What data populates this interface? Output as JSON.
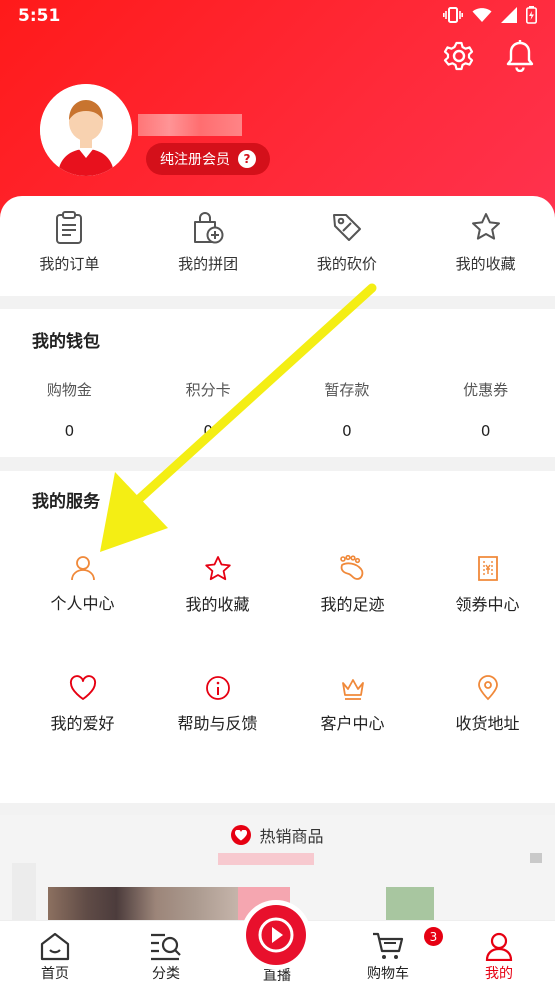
{
  "status_bar": {
    "time": "5:51"
  },
  "profile": {
    "member_label": "纯注册会员",
    "help_glyph": "?"
  },
  "quick_links": [
    {
      "label": "我的订单",
      "icon": "order-clipboard-icon"
    },
    {
      "label": "我的拼团",
      "icon": "group-buy-bag-icon"
    },
    {
      "label": "我的砍价",
      "icon": "bargain-tag-icon"
    },
    {
      "label": "我的收藏",
      "icon": "favorite-star-icon"
    }
  ],
  "wallet": {
    "title": "我的钱包",
    "items": [
      {
        "label": "购物金",
        "value": "0"
      },
      {
        "label": "积分卡",
        "value": "0"
      },
      {
        "label": "暂存款",
        "value": "0"
      },
      {
        "label": "优惠券",
        "value": "0"
      }
    ]
  },
  "services": {
    "title": "我的服务",
    "items": [
      {
        "label": "个人中心",
        "icon": "person-icon"
      },
      {
        "label": "我的收藏",
        "icon": "star-icon"
      },
      {
        "label": "我的足迹",
        "icon": "footprint-icon"
      },
      {
        "label": "领券中心",
        "icon": "coupon-icon"
      },
      {
        "label": "我的爱好",
        "icon": "heart-icon"
      },
      {
        "label": "帮助与反馈",
        "icon": "info-icon"
      },
      {
        "label": "客户中心",
        "icon": "crown-icon"
      },
      {
        "label": "收货地址",
        "icon": "location-pin-icon"
      }
    ]
  },
  "hot_products": {
    "title": "热销商品"
  },
  "tabbar": {
    "items": [
      {
        "label": "首页"
      },
      {
        "label": "分类"
      },
      {
        "label": "直播"
      },
      {
        "label": "购物车"
      },
      {
        "label": "我的"
      }
    ],
    "cart_badge": "3"
  },
  "colors": {
    "brand_red": "#e60012",
    "service_orange": "#f0893a",
    "active_tab": "#e60012"
  }
}
